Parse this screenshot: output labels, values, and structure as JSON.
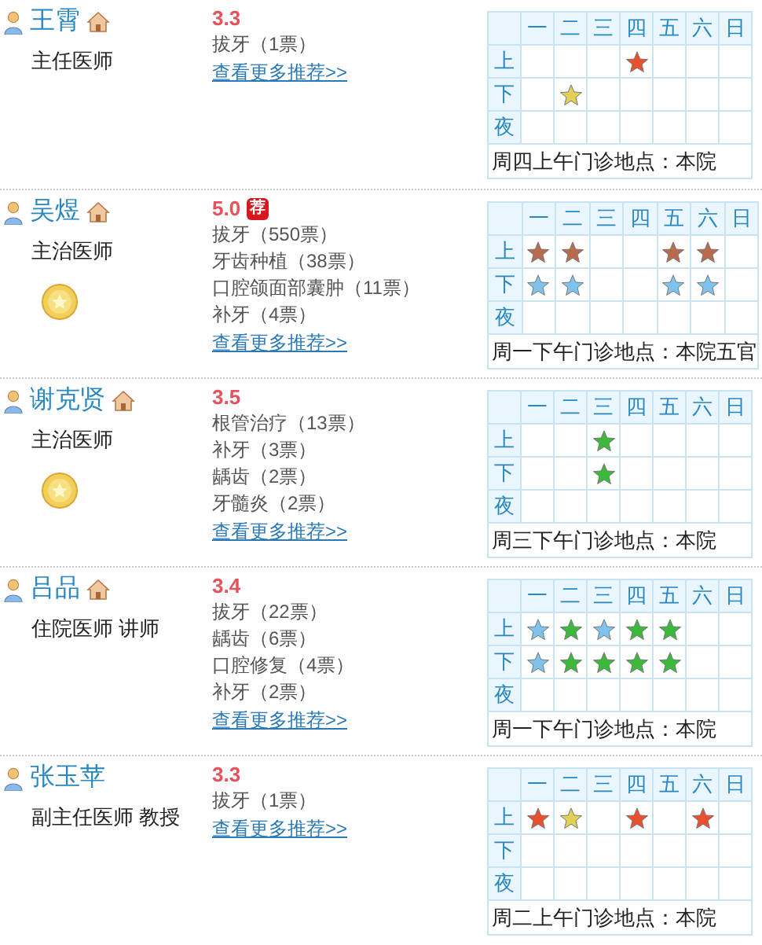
{
  "doctors": [
    {
      "name": "王霄",
      "weekdays": [
        "一",
        "二",
        "三",
        "四",
        "五",
        "六",
        "日"
      ],
      "home_icon": true,
      "title": "主任医师",
      "medal": false,
      "rating": "3.3",
      "items": [
        "拔牙（1票）"
      ],
      "more_link": "查看更多推荐>>",
      "schedule": [
        {
          "label": "上",
          "cells": [
            {
              "starred": false
            },
            {
              "starred": false
            },
            {
              "starred": false
            },
            {
              "starred": true,
              "color": "#e8502e"
            },
            {
              "starred": false
            },
            {
              "starred": false
            },
            {
              "starred": false
            }
          ]
        },
        {
          "label": "下",
          "cells": [
            {
              "starred": false
            },
            {
              "starred": true,
              "color": "#e2cf55"
            },
            {
              "starred": false
            },
            {
              "starred": false
            },
            {
              "starred": false
            },
            {
              "starred": false
            },
            {
              "starred": false
            }
          ]
        },
        {
          "label": "夜",
          "cells": [
            {
              "starred": false
            },
            {
              "starred": false
            },
            {
              "starred": false
            },
            {
              "starred": false
            },
            {
              "starred": false
            },
            {
              "starred": false
            },
            {
              "starred": false
            }
          ]
        }
      ],
      "location": "周四上午门诊地点：本院"
    },
    {
      "name": "吴煜",
      "weekdays": [
        "一",
        "二",
        "三",
        "四",
        "五",
        "六",
        "日"
      ],
      "home_icon": true,
      "title": "主治医师",
      "medal": true,
      "rating": "5.0",
      "tag": "荐",
      "items": [
        "拔牙（550票）",
        "牙齿种植（38票）",
        "口腔颌面部囊肿（11票）",
        "补牙（4票）"
      ],
      "more_link": "查看更多推荐>>",
      "schedule": [
        {
          "label": "上",
          "cells": [
            {
              "starred": true,
              "color": "#b86a4e"
            },
            {
              "starred": true,
              "color": "#b86a4e"
            },
            {
              "starred": false
            },
            {
              "starred": false
            },
            {
              "starred": true,
              "color": "#b86a4e"
            },
            {
              "starred": true,
              "color": "#b86a4e"
            },
            {
              "starred": false
            }
          ]
        },
        {
          "label": "下",
          "cells": [
            {
              "starred": true,
              "color": "#7ec3ee"
            },
            {
              "starred": true,
              "color": "#7ec3ee"
            },
            {
              "starred": false
            },
            {
              "starred": false
            },
            {
              "starred": true,
              "color": "#7ec3ee"
            },
            {
              "starred": true,
              "color": "#7ec3ee"
            },
            {
              "starred": false
            }
          ]
        },
        {
          "label": "夜",
          "cells": [
            {
              "starred": false
            },
            {
              "starred": false
            },
            {
              "starred": false
            },
            {
              "starred": false
            },
            {
              "starred": false
            },
            {
              "starred": false
            },
            {
              "starred": false
            }
          ]
        }
      ],
      "location": "周一下午门诊地点：本院五官"
    },
    {
      "name": "谢克贤",
      "weekdays": [
        "一",
        "二",
        "三",
        "四",
        "五",
        "六",
        "日"
      ],
      "home_icon": true,
      "title": "主治医师",
      "medal": true,
      "rating": "3.5",
      "items": [
        "根管治疗（13票）",
        "补牙（3票）",
        "龋齿（2票）",
        "牙髓炎（2票）"
      ],
      "more_link": "查看更多推荐>>",
      "schedule": [
        {
          "label": "上",
          "cells": [
            {
              "starred": false
            },
            {
              "starred": false
            },
            {
              "starred": true,
              "color": "#3cb83c"
            },
            {
              "starred": false
            },
            {
              "starred": false
            },
            {
              "starred": false
            },
            {
              "starred": false
            }
          ]
        },
        {
          "label": "下",
          "cells": [
            {
              "starred": false
            },
            {
              "starred": false
            },
            {
              "starred": true,
              "color": "#3cb83c"
            },
            {
              "starred": false
            },
            {
              "starred": false
            },
            {
              "starred": false
            },
            {
              "starred": false
            }
          ]
        },
        {
          "label": "夜",
          "cells": [
            {
              "starred": false
            },
            {
              "starred": false
            },
            {
              "starred": false
            },
            {
              "starred": false
            },
            {
              "starred": false
            },
            {
              "starred": false
            },
            {
              "starred": false
            }
          ]
        }
      ],
      "location": "周三下午门诊地点：本院"
    },
    {
      "name": "吕品",
      "weekdays": [
        "一",
        "二",
        "三",
        "四",
        "五",
        "六",
        "日"
      ],
      "home_icon": true,
      "title": "住院医师 讲师",
      "medal": false,
      "rating": "3.4",
      "items": [
        "拔牙（22票）",
        "龋齿（6票）",
        "口腔修复（4票）",
        "补牙（2票）"
      ],
      "more_link": "查看更多推荐>>",
      "schedule": [
        {
          "label": "上",
          "cells": [
            {
              "starred": true,
              "color": "#7ec3ee"
            },
            {
              "starred": true,
              "color": "#3cb83c"
            },
            {
              "starred": true,
              "color": "#7ec3ee"
            },
            {
              "starred": true,
              "color": "#3cb83c"
            },
            {
              "starred": true,
              "color": "#3cb83c"
            },
            {
              "starred": false
            },
            {
              "starred": false
            }
          ]
        },
        {
          "label": "下",
          "cells": [
            {
              "starred": true,
              "color": "#7ec3ee"
            },
            {
              "starred": true,
              "color": "#3cb83c"
            },
            {
              "starred": true,
              "color": "#3cb83c"
            },
            {
              "starred": true,
              "color": "#3cb83c"
            },
            {
              "starred": true,
              "color": "#3cb83c"
            },
            {
              "starred": false
            },
            {
              "starred": false
            }
          ]
        },
        {
          "label": "夜",
          "cells": [
            {
              "starred": false
            },
            {
              "starred": false
            },
            {
              "starred": false
            },
            {
              "starred": false
            },
            {
              "starred": false
            },
            {
              "starred": false
            },
            {
              "starred": false
            }
          ]
        }
      ],
      "location": "周一下午门诊地点：本院"
    },
    {
      "name": "张玉苹",
      "weekdays": [
        "一",
        "二",
        "三",
        "四",
        "五",
        "六",
        "日"
      ],
      "home_icon": false,
      "title": "副主任医师 教授",
      "medal": false,
      "rating": "3.3",
      "items": [
        "拔牙（1票）"
      ],
      "more_link": "查看更多推荐>>",
      "schedule": [
        {
          "label": "上",
          "cells": [
            {
              "starred": true,
              "color": "#e8502e"
            },
            {
              "starred": true,
              "color": "#e2cf55"
            },
            {
              "starred": false
            },
            {
              "starred": true,
              "color": "#e8502e"
            },
            {
              "starred": false
            },
            {
              "starred": true,
              "color": "#e8502e"
            },
            {
              "starred": false
            }
          ]
        },
        {
          "label": "下",
          "cells": [
            {
              "starred": false
            },
            {
              "starred": false
            },
            {
              "starred": false
            },
            {
              "starred": false
            },
            {
              "starred": false
            },
            {
              "starred": false
            },
            {
              "starred": false
            }
          ]
        },
        {
          "label": "夜",
          "cells": [
            {
              "starred": false
            },
            {
              "starred": false
            },
            {
              "starred": false
            },
            {
              "starred": false
            },
            {
              "starred": false
            },
            {
              "starred": false
            },
            {
              "starred": false
            }
          ]
        }
      ],
      "location": "周二上午门诊地点：本院"
    }
  ]
}
